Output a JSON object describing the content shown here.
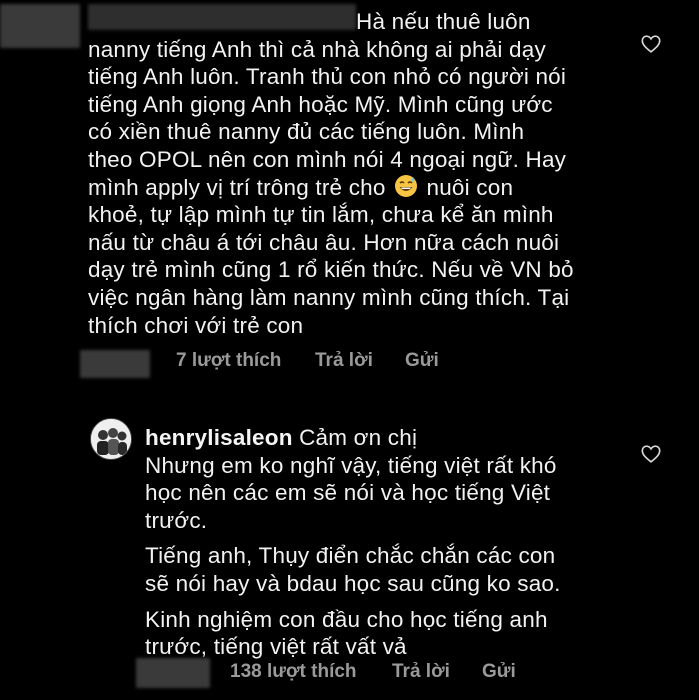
{
  "comment1": {
    "lines": [
      "Hà nếu thuê luôn",
      "nanny tiếng Anh thì cả nhà không ai phải dạy",
      "tiếng Anh luôn. Tranh thủ con nhỏ có người nói",
      "tiếng Anh giọng Anh hoặc Mỹ. Mình cũng ước",
      "có xiền thuê nanny đủ các tiếng luôn. Mình",
      "theo OPOL nên con mình nói 4 ngoại ngữ. Hay",
      "mình apply vị trí trông trẻ cho",
      "khoẻ, tự lập mình tự tin lắm, chưa kể ăn mình",
      "nấu từ châu á tới châu âu. Hơn nữa cách nuôi",
      "dạy trẻ mình cũng 1 rổ kiến thức. Nếu về VN bỏ",
      "việc ngân hàng làm nanny mình cũng thích. Tại",
      "thích chơi với trẻ con"
    ],
    "line7_tail": "nuôi con",
    "likes": "7 lượt thích",
    "reply": "Trả lời",
    "send": "Gửi"
  },
  "comment2": {
    "username": "henrylisaleon",
    "first": "Cảm ơn chị",
    "para1": [
      "Nhưng em ko nghĩ vậy, tiếng việt rất khó",
      "học nên các em sẽ nói và học tiếng Việt",
      "trước."
    ],
    "para2": [
      "Tiếng anh, Thụy điển chắc chắn các con",
      "sẽ nói hay và bdau học sau cũng ko sao."
    ],
    "para3": [
      "Kinh nghiệm con đầu cho học tiếng anh",
      "trước, tiếng việt rất vất vả"
    ],
    "likes": "138 lượt thích",
    "reply": "Trả lời",
    "send": "Gửi"
  },
  "icons": {
    "heart": "heart-outline-icon",
    "emoji": "grinning-sweat-emoji"
  },
  "colors": {
    "background": "#000000",
    "text": "#f2f2f2",
    "meta": "#9a9a9a"
  }
}
